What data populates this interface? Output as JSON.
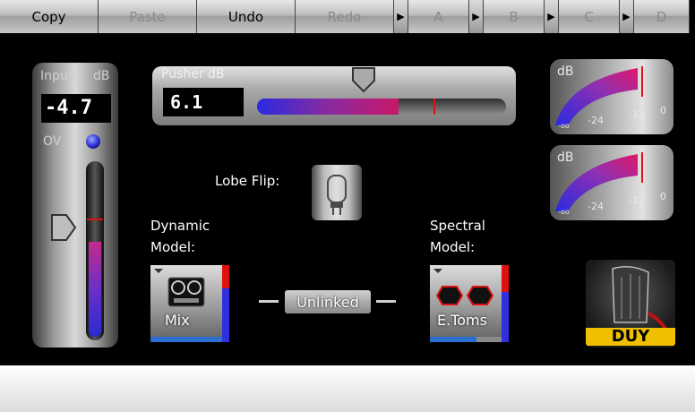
{
  "toolbar": {
    "copy": "Copy",
    "paste": "Paste",
    "undo": "Undo",
    "redo": "Redo",
    "slot_a": "A",
    "slot_b": "B",
    "slot_c": "C",
    "slot_d": "D"
  },
  "input": {
    "label": "Input",
    "unit": "dB",
    "value": "-4.7",
    "ov_label": "OV",
    "fader_level": 0.55
  },
  "pusher": {
    "label": "Pusher dB",
    "value": "6.1",
    "meter_level": 0.57,
    "peak_level": 0.71
  },
  "meters": {
    "unit": "dB",
    "tick_neg24": "-24",
    "tick_neg12": "-12",
    "tick_0": "0",
    "tick_inf": "-oo"
  },
  "lobe_flip": {
    "label": "Lobe Flip:"
  },
  "dynamic": {
    "label_line1": "Dynamic",
    "label_line2": "Model:",
    "value": "Mix"
  },
  "spectral": {
    "label_line1": "Spectral",
    "label_line2": "Model:",
    "value": "E.Toms"
  },
  "link": {
    "label": "Unlinked"
  },
  "logo": {
    "text": "DUY"
  },
  "colors": {
    "accent_red": "#e01010",
    "meter_blue": "#3030e0",
    "bar_blue": "#2a6fd0"
  }
}
